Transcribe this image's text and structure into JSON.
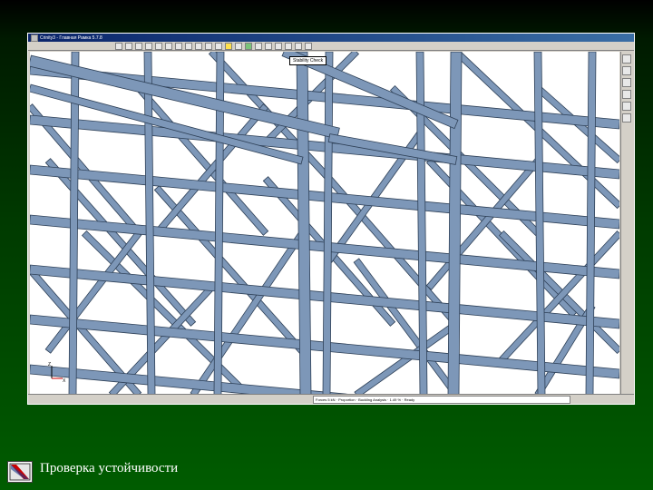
{
  "window": {
    "title": "Сrinity3 - Главная Рамка 5.7.8",
    "view_label": "Stability Check",
    "axis_x": "X",
    "axis_z": "Z",
    "status_text": "Forces 5 kN · Proportion · Buckling Analysis · 1.49 % · Ready"
  },
  "toolbar": {
    "icons": [
      "new-icon",
      "open-icon",
      "save-icon",
      "print-icon",
      "cut-icon",
      "copy-icon",
      "paste-icon",
      "undo-icon",
      "redo-icon",
      "zoom-icon",
      "select-icon",
      "highlight-icon",
      "node-icon",
      "beam-icon",
      "rotate-icon",
      "pan-icon",
      "fit-icon",
      "view-icon",
      "settings-icon",
      "help-icon"
    ]
  },
  "slide": {
    "caption": "Проверка устойчивости"
  },
  "colors": {
    "member_fill": "#7d97b8",
    "member_edge": "#2e4057",
    "background_top": "#000000",
    "background_bottom": "#005c00"
  }
}
